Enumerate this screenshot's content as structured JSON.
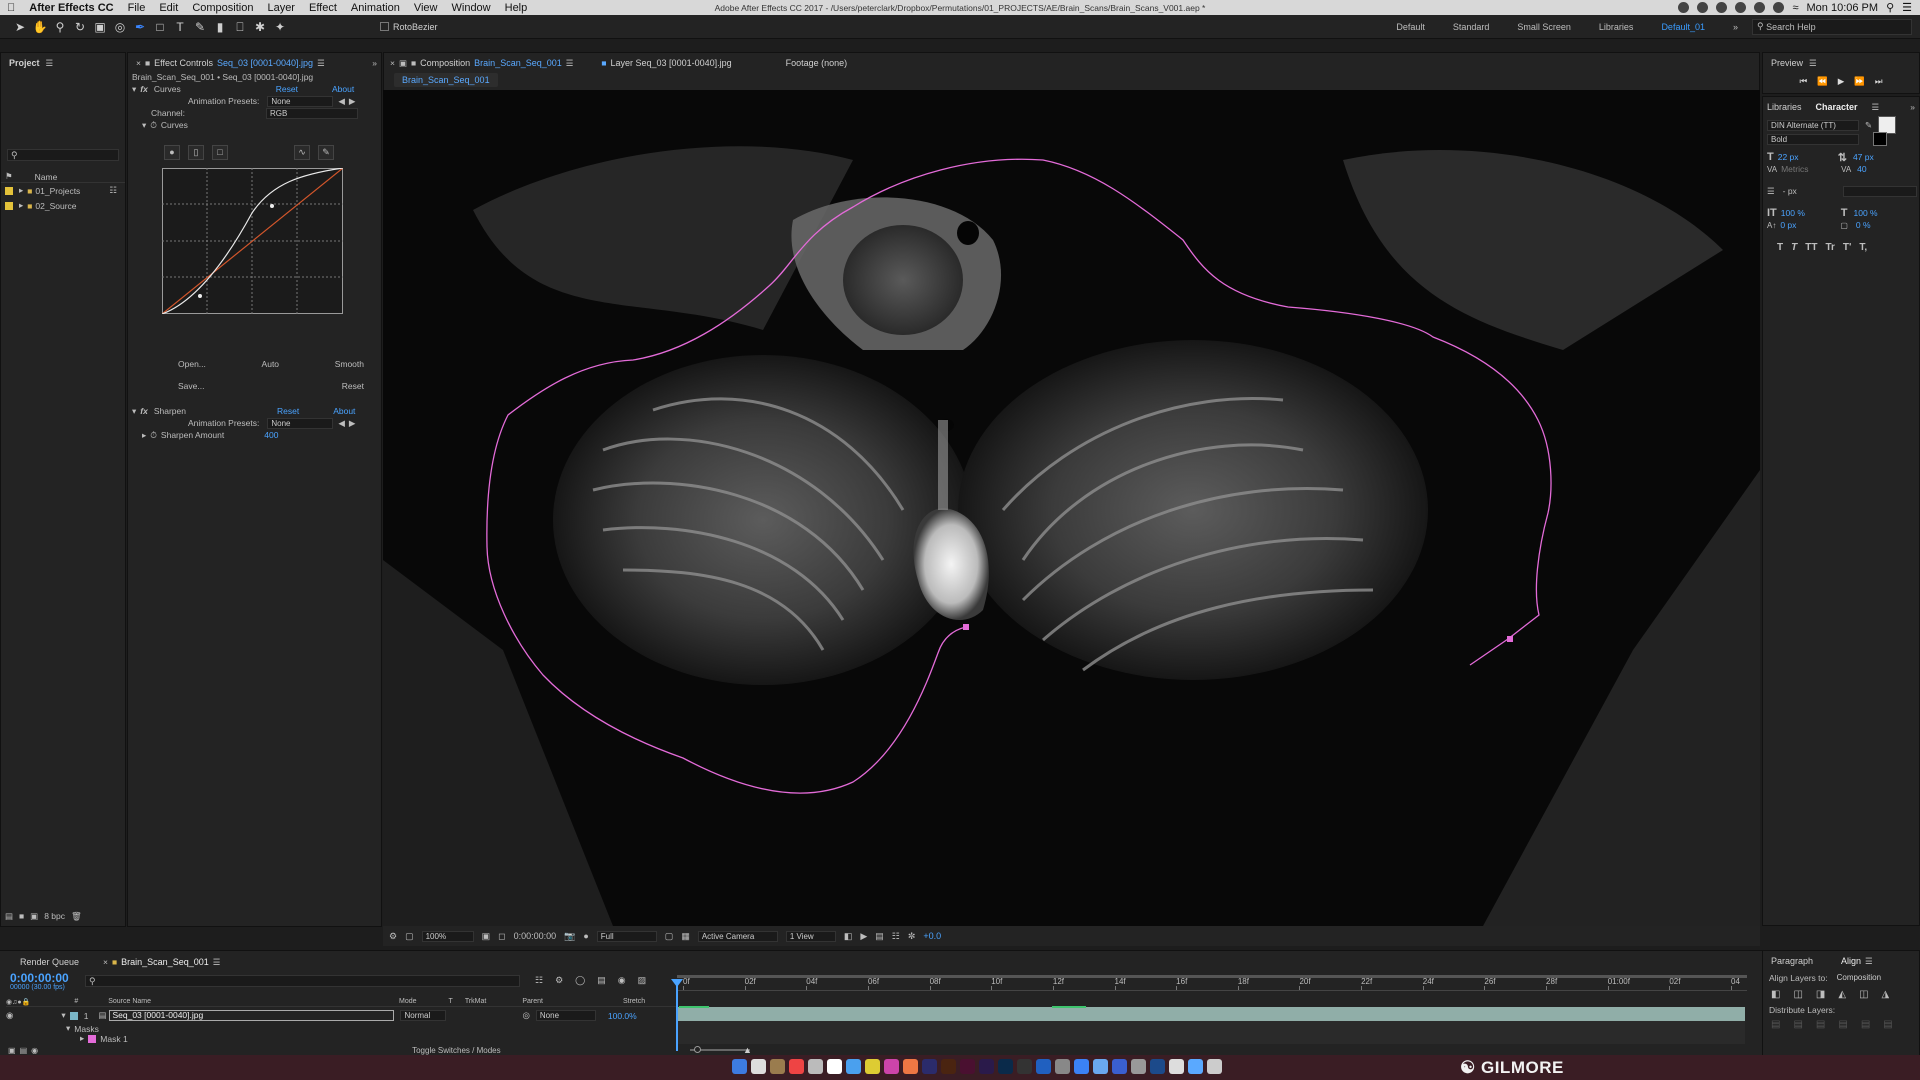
{
  "menubar": {
    "app_name": "After Effects CC",
    "items": [
      "File",
      "Edit",
      "Composition",
      "Layer",
      "Effect",
      "Animation",
      "View",
      "Window",
      "Help"
    ],
    "window_title": "Adobe After Effects CC 2017 - /Users/peterclark/Dropbox/Permutations/01_PROJECTS/AE/Brain_Scans/Brain_Scans_V001.aep *",
    "clock": "Mon 10:06 PM"
  },
  "toolbar": {
    "rotobezier_label": "RotoBezier",
    "workspaces": [
      "Default",
      "Standard",
      "Small Screen",
      "Libraries",
      "Default_01"
    ],
    "active_workspace": "Default_01",
    "search_placeholder": "Search Help"
  },
  "project": {
    "title": "Project",
    "search_placeholder": "",
    "col_name": "Name",
    "items": [
      "01_Projects",
      "02_Source"
    ],
    "bpc": "8 bpc"
  },
  "effect_controls": {
    "tab_prefix": "Effect Controls",
    "tab_layer": "Seq_03 [0001-0040].jpg",
    "breadcrumb": "Brain_Scan_Seq_001 • Seq_03 [0001-0040].jpg",
    "curves": {
      "name": "Curves",
      "reset": "Reset",
      "about": "About",
      "presets_label": "Animation Presets:",
      "presets_value": "None",
      "channel_label": "Channel:",
      "channel_value": "RGB",
      "sub_label": "Curves",
      "open": "Open...",
      "auto": "Auto",
      "smooth": "Smooth",
      "save": "Save...",
      "reset2": "Reset"
    },
    "sharpen": {
      "name": "Sharpen",
      "reset": "Reset",
      "about": "About",
      "presets_label": "Animation Presets:",
      "presets_value": "None",
      "amount_label": "Sharpen Amount",
      "amount_value": "400"
    }
  },
  "composition": {
    "tab_prefix": "Composition",
    "tab_comp": "Brain_Scan_Seq_001",
    "tab_layer": "Layer Seq_03 [0001-0040].jpg",
    "tab_footage": "Footage (none)",
    "breadcrumb": "Brain_Scan_Seq_001",
    "zoom": "100%",
    "timecode": "0:00:00:00",
    "resolution": "Full",
    "camera": "Active Camera",
    "view": "1 View",
    "exposure": "+0.0"
  },
  "preview": {
    "title": "Preview"
  },
  "character": {
    "tab_libraries": "Libraries",
    "tab_character": "Character",
    "font": "DIN Alternate (TT)",
    "style": "Bold",
    "size": "22 px",
    "leading": "47 px",
    "kerning": "Metrics",
    "tracking": "40",
    "stroke": "- px",
    "vscale": "100 %",
    "hscale": "100 %",
    "baseline": "0 px",
    "tsume": "0 %",
    "styles": [
      "T",
      "T",
      "TT",
      "Tr",
      "T'",
      "T,"
    ]
  },
  "align": {
    "tab_paragraph": "Paragraph",
    "tab_align": "Align",
    "align_to_label": "Align Layers to:",
    "align_to_value": "Composition",
    "distribute_label": "Distribute Layers:"
  },
  "timeline": {
    "render_queue": "Render Queue",
    "comp_tab": "Brain_Scan_Seq_001",
    "timecode": "0:00:00:00",
    "fps": "00000 (30.00 fps)",
    "cols": {
      "source": "Source Name",
      "mode": "Mode",
      "t": "T",
      "trkmat": "TrkMat",
      "parent": "Parent",
      "stretch": "Stretch"
    },
    "layer": {
      "num": "1",
      "name": "Seq_03 [0001-0040].jpg",
      "mode": "Normal",
      "parent": "None",
      "stretch": "100.0%"
    },
    "masks_label": "Masks",
    "mask1": "Mask 1",
    "ruler": [
      "0f",
      "02f",
      "04f",
      "06f",
      "08f",
      "10f",
      "12f",
      "14f",
      "16f",
      "18f",
      "20f",
      "22f",
      "24f",
      "26f",
      "28f",
      "01:00f",
      "02f",
      "04"
    ],
    "toggle": "Toggle Switches / Modes"
  },
  "watermark": "GILMORE",
  "colors": {
    "accent": "#4aa3ff",
    "mask": "#e36bd8",
    "panel": "#232323"
  }
}
